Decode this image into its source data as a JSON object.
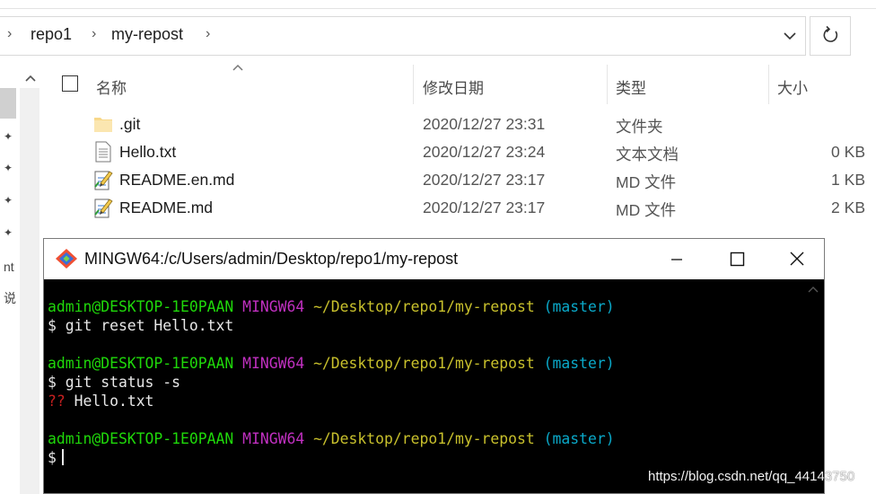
{
  "breadcrumb": {
    "items": [
      "repo1",
      "my-repost"
    ]
  },
  "columns": {
    "name": "名称",
    "modified": "修改日期",
    "type": "类型",
    "size": "大小"
  },
  "files": [
    {
      "name": ".git",
      "modified": "2020/12/27 23:31",
      "type": "文件夹",
      "size": "",
      "icon": "folder-icon"
    },
    {
      "name": "Hello.txt",
      "modified": "2020/12/27 23:24",
      "type": "文本文档",
      "size": "0 KB",
      "icon": "text-file-icon"
    },
    {
      "name": "README.en.md",
      "modified": "2020/12/27 23:17",
      "type": "MD 文件",
      "size": "1 KB",
      "icon": "markdown-file-icon"
    },
    {
      "name": "README.md",
      "modified": "2020/12/27 23:17",
      "type": "MD 文件",
      "size": "2 KB",
      "icon": "markdown-file-icon"
    }
  ],
  "left_pane": {
    "fragments": [
      "nt",
      "说"
    ]
  },
  "terminal": {
    "title": "MINGW64:/c/Users/admin/Desktop/repo1/my-repost",
    "prompt_user": "admin@DESKTOP-1E0PAAN",
    "prompt_env": "MINGW64",
    "prompt_path": "~/Desktop/repo1/my-repost",
    "prompt_branch": "(master)",
    "commands": [
      "$ git reset Hello.txt",
      "$ git status -s",
      "$"
    ],
    "status_marker": "??",
    "status_file": " Hello.txt"
  },
  "watermark": "https://blog.csdn.net/qq_44143750",
  "colors": {
    "prompt_user": "#1fd80a",
    "prompt_env": "#c030c0",
    "prompt_path": "#c8c02c",
    "prompt_branch": "#0aa8c8",
    "untracked": "#c42020"
  }
}
